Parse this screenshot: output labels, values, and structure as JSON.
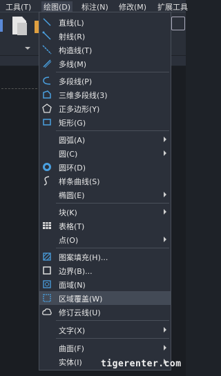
{
  "menubar": {
    "tools": "工具(T)",
    "draw": "绘图(D)",
    "annotate": "标注(N)",
    "modify": "修改(M)",
    "extend": "扩展工具"
  },
  "menu": {
    "items": [
      {
        "label": "直线(L)"
      },
      {
        "label": "射线(R)"
      },
      {
        "label": "构造线(T)"
      },
      {
        "label": "多线(M)"
      },
      {
        "label": "多段线(P)"
      },
      {
        "label": "三维多段线(3)"
      },
      {
        "label": "正多边形(Y)"
      },
      {
        "label": "矩形(G)"
      },
      {
        "label": "圆弧(A)"
      },
      {
        "label": "圆(C)"
      },
      {
        "label": "圆环(D)"
      },
      {
        "label": "样条曲线(S)"
      },
      {
        "label": "椭圆(E)"
      },
      {
        "label": "块(K)"
      },
      {
        "label": "表格(T)"
      },
      {
        "label": "点(O)"
      },
      {
        "label": "图案填充(H)..."
      },
      {
        "label": "边界(B)..."
      },
      {
        "label": "面域(N)"
      },
      {
        "label": "区域覆盖(W)"
      },
      {
        "label": "修订云线(U)"
      },
      {
        "label": "文字(X)"
      },
      {
        "label": "曲面(F)"
      },
      {
        "label": "实体(I)"
      }
    ]
  },
  "watermark": "tigerenter.com",
  "colors": {
    "icon_blue": "#4aa0e0",
    "highlight": "#434a56",
    "background": "#2b303a"
  }
}
